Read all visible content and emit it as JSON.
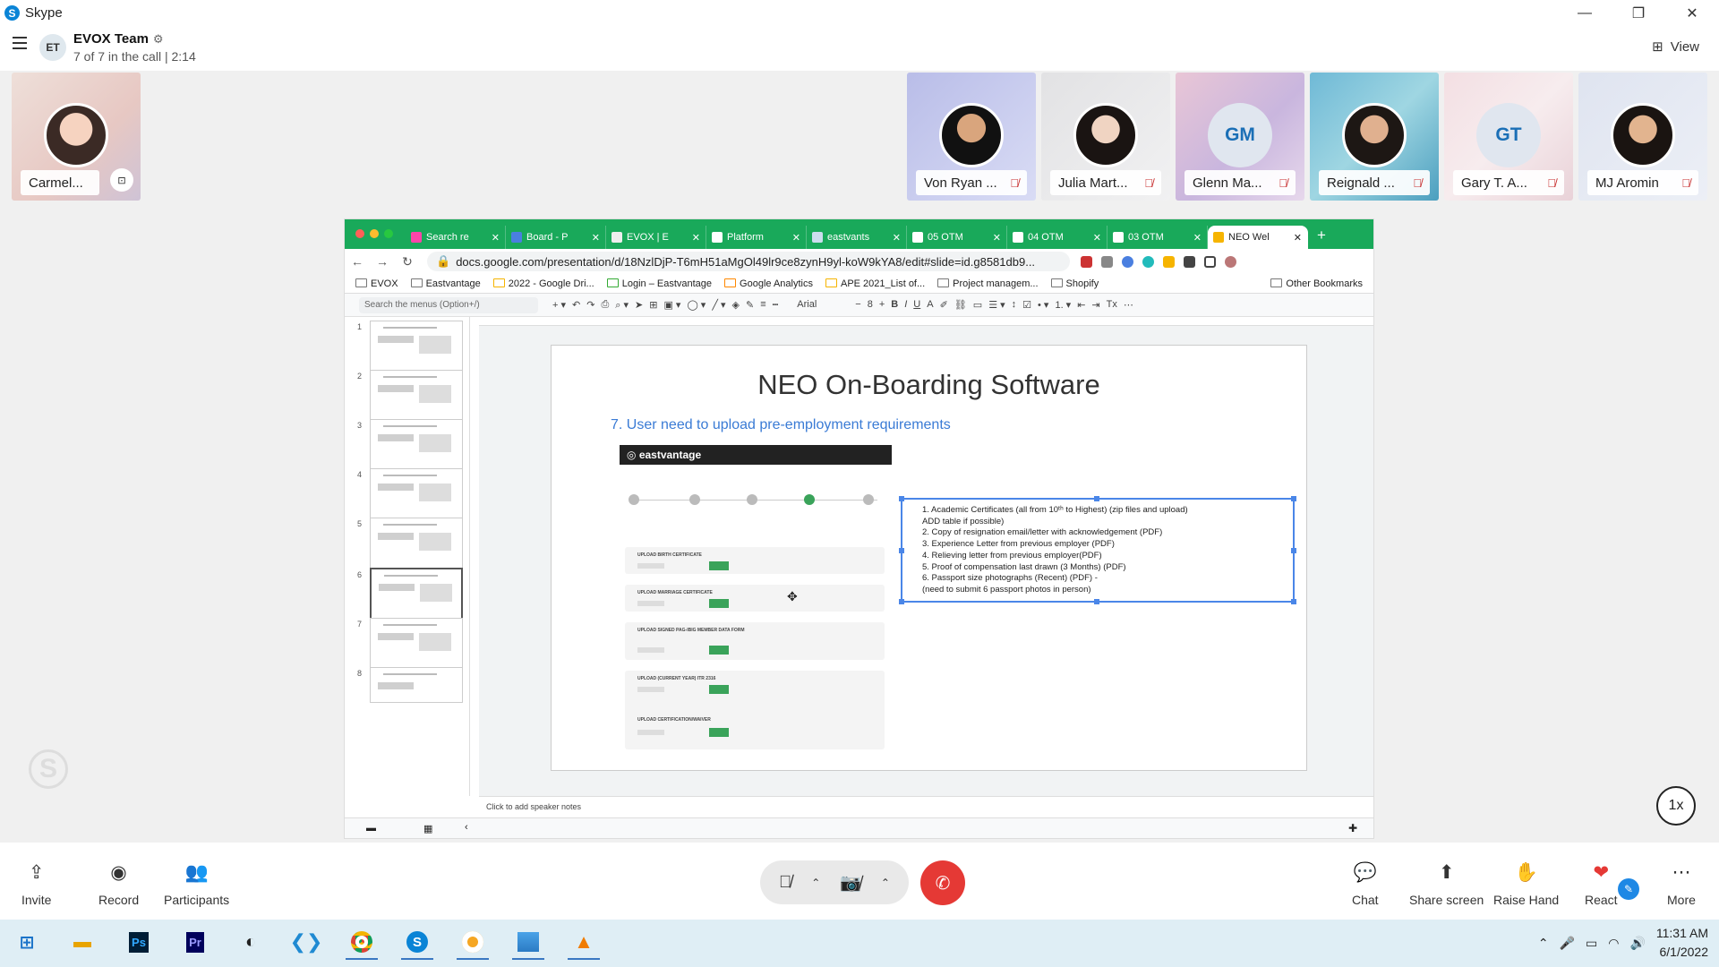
{
  "window": {
    "app_title": "Skype",
    "minimize": "—",
    "restore": "❐",
    "close": "✕"
  },
  "header": {
    "group_initials": "ET",
    "group_name": "EVOX Team",
    "call_status": "7 of 7 in the call | 2:14",
    "view_label": "View"
  },
  "self_tile": {
    "name": "Carmel..."
  },
  "participants": [
    {
      "name": "Von Ryan ...",
      "initials": ""
    },
    {
      "name": "Julia Mart...",
      "initials": ""
    },
    {
      "name": "Glenn Ma...",
      "initials": "GM"
    },
    {
      "name": "Reignald ...",
      "initials": ""
    },
    {
      "name": "Gary T. A...",
      "initials": "GT"
    },
    {
      "name": "MJ Aromin",
      "initials": ""
    }
  ],
  "browser": {
    "tabs": [
      "Search re",
      "Board - P",
      "EVOX | E",
      "Platform",
      "eastvants",
      "05 OTM",
      "04 OTM",
      "03 OTM",
      "NEO Wel"
    ],
    "url": "docs.google.com/presentation/d/18NzlDjP-T6mH51aMgOl49lr9ce8zynH9yl-koW9kYA8/edit#slide=id.g8581db9...",
    "bookmarks": [
      "EVOX",
      "Eastvantage",
      "2022 - Google Dri...",
      "Login – Eastvantage",
      "Google Analytics",
      "APE 2021_List of...",
      "Project managem...",
      "Shopify"
    ],
    "other_bookmarks": "Other Bookmarks",
    "menu_search": "Search the menus (Option+/)",
    "font": "Arial"
  },
  "slide": {
    "title": "NEO On-Boarding Software",
    "subtitle": "7. User need to upload pre-employment requirements",
    "mock_header": "eastvantage",
    "requirements": [
      "1.     Academic Certificates (all from 10ᵗʰ to Highest)  (zip files and upload)",
      "        ADD table if possible)",
      "2.     Copy of resignation email/letter with acknowledgement (PDF)",
      "3.     Experience Letter from previous employer (PDF)",
      "4.     Relieving letter from previous employer(PDF)",
      "5.     Proof of compensation last drawn (3 Months) (PDF)",
      "6.     Passport size photographs (Recent) (PDF) -",
      "         (need to submit 6 passport photos in person)"
    ],
    "speaker_notes": "Click to add speaker notes",
    "thumb_numbers": [
      "1",
      "2",
      "3",
      "4",
      "5",
      "6",
      "7",
      "8"
    ],
    "upload_rows": [
      "UPLOAD BIRTH CERTIFICATE",
      "UPLOAD MARRIAGE CERTIFICATE",
      "UPLOAD SIGNED PAG-IBIG MEMBER DATA FORM",
      "UPLOAD (CURRENT YEAR) ITR 2316",
      "UPLOAD CERTIFICATION/WAIVER"
    ]
  },
  "playback_speed": "1x",
  "controls": {
    "invite": "Invite",
    "record": "Record",
    "participants": "Participants",
    "chat": "Chat",
    "share_screen": "Share screen",
    "raise_hand": "Raise Hand",
    "react": "React",
    "more": "More"
  },
  "taskbar": {
    "time": "11:31 AM",
    "date": "6/1/2022"
  },
  "colors": {
    "skype_blue": "#0a84d6",
    "end_call": "#e53935",
    "slides_green": "#19a95a",
    "mute_red": "#c62828"
  }
}
